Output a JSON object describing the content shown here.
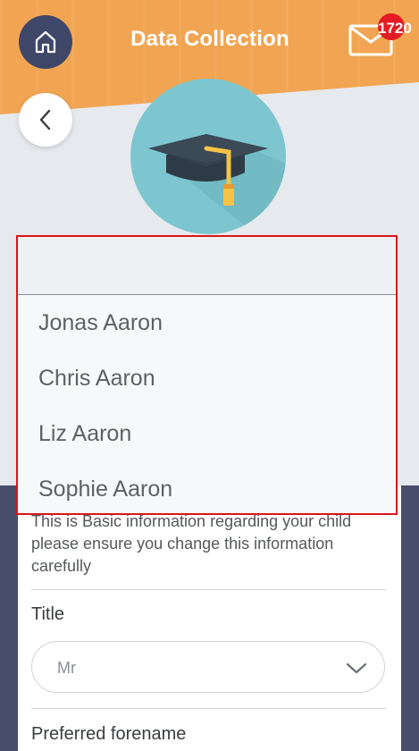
{
  "header": {
    "title": "Data Collection",
    "mail_badge_count": "1720"
  },
  "dropdown": {
    "options": [
      "Jonas Aaron",
      "Chris Aaron",
      "Liz Aaron",
      "Sophie Aaron"
    ]
  },
  "form": {
    "intro": "This is Basic information regarding your child please ensure you change this information carefully",
    "title_label": "Title",
    "title_value": "Mr",
    "preferred_forename_label": "Preferred forename"
  },
  "colors": {
    "header": "#f1a552",
    "nav_button": "#3f4769",
    "badge": "#e41b23",
    "avatar": "#7dc6cf",
    "dark_band": "#474e6b",
    "highlight_border": "#d9141c"
  },
  "icons": {
    "home": "home-icon",
    "mail": "mail-icon",
    "back": "chevron-left-icon",
    "avatar": "graduation-cap-icon",
    "select": "chevron-down-icon"
  }
}
